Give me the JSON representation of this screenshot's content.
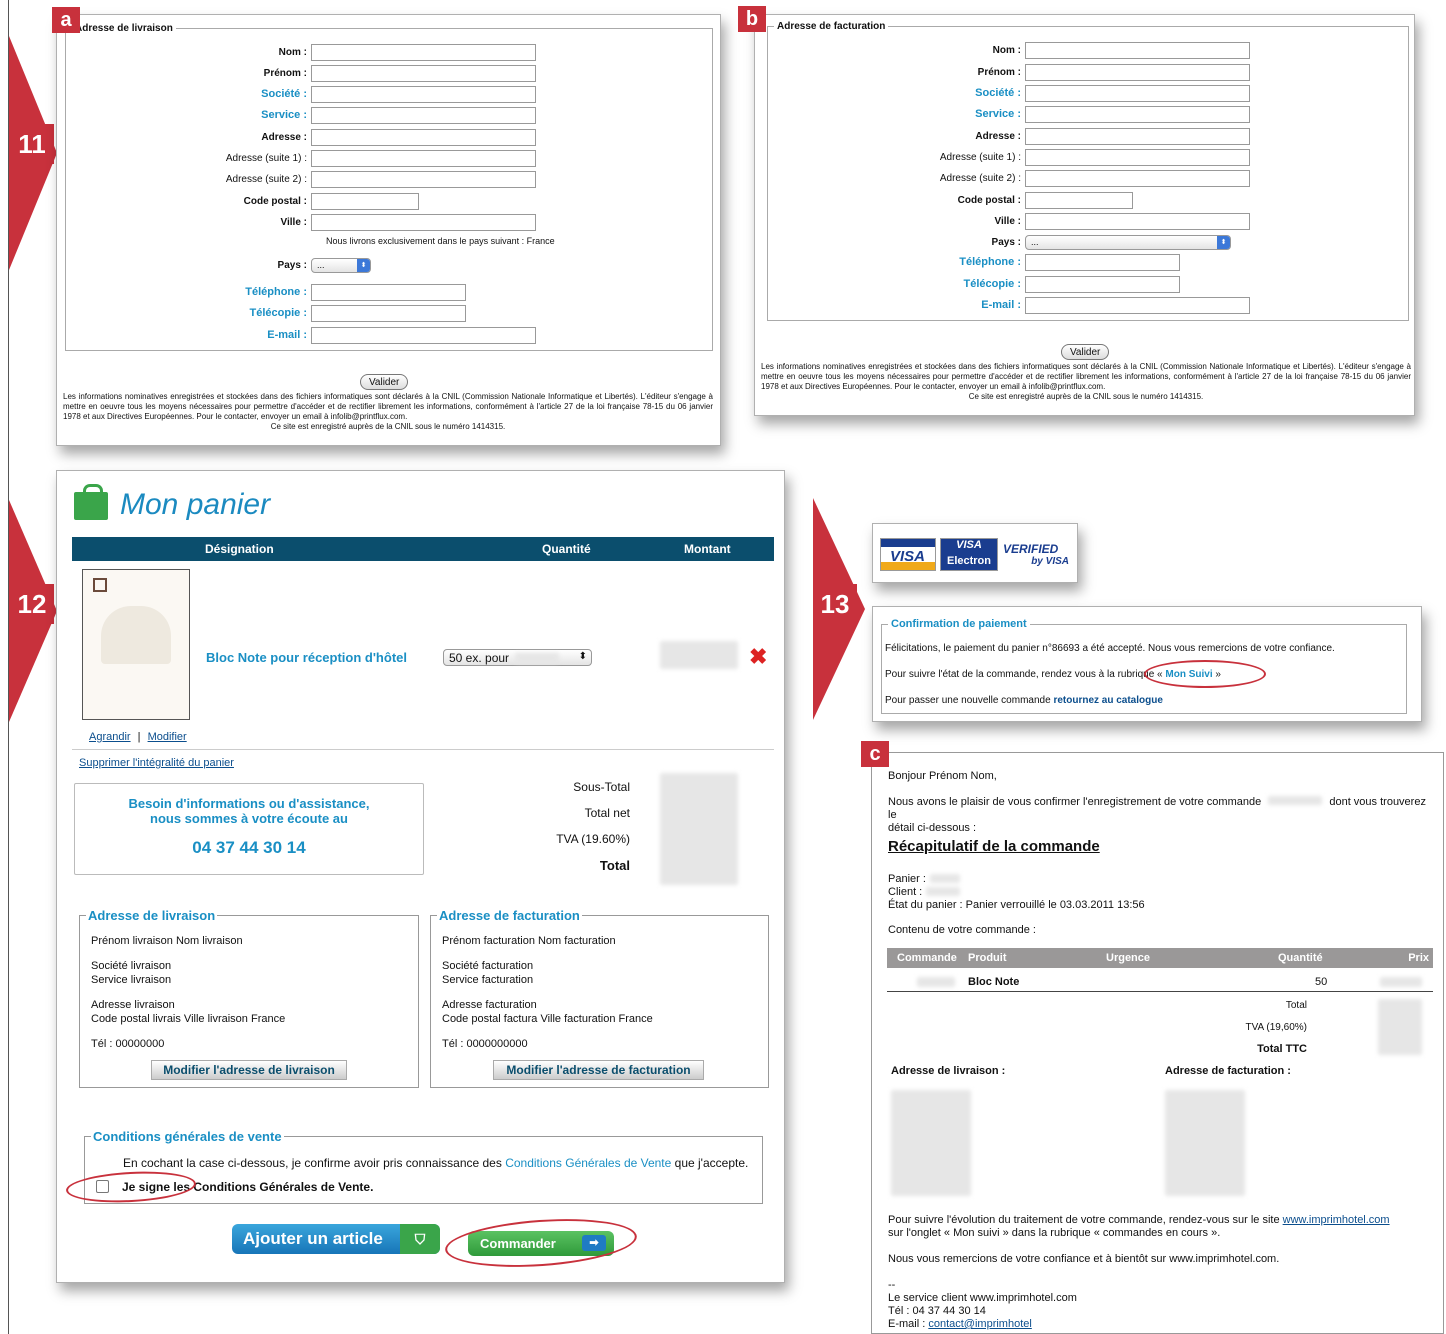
{
  "steps": {
    "s11": "11",
    "s12": "12",
    "s13": "13"
  },
  "tags": {
    "a": "a",
    "b": "b",
    "c": "c"
  },
  "formA": {
    "legend": "Adresse de livraison",
    "labels": {
      "nom": "Nom :",
      "prenom": "Prénom :",
      "societe": "Société :",
      "service": "Service :",
      "adresse": "Adresse :",
      "adresse1": "Adresse (suite 1) :",
      "adresse2": "Adresse (suite 2) :",
      "cp": "Code postal :",
      "ville": "Ville :",
      "pays": "Pays :",
      "tel": "Téléphone :",
      "fax": "Télécopie :",
      "email": "E-mail :"
    },
    "note": "Nous livrons exclusivement dans le pays suivant : France",
    "pays_value": "...",
    "submit": "Valider"
  },
  "formB": {
    "legend": "Adresse de facturation",
    "labels": {
      "nom": "Nom :",
      "prenom": "Prénom :",
      "societe": "Société :",
      "service": "Service :",
      "adresse": "Adresse :",
      "adresse1": "Adresse (suite 1) :",
      "adresse2": "Adresse (suite 2) :",
      "cp": "Code postal :",
      "ville": "Ville :",
      "pays": "Pays :",
      "tel": "Téléphone :",
      "fax": "Télécopie :",
      "email": "E-mail :"
    },
    "pays_value": "...",
    "submit": "Valider"
  },
  "legal": {
    "text": "Les informations nominatives enregistrées et stockées dans des fichiers informatiques sont déclarés à la CNIL (Commission Nationale Informatique et Libertés). L'éditeur s'engage à mettre en oeuvre tous les moyens nécessaires pour permettre d'accéder et de rectifier librement les informations, conformément à l'article 27 de la loi française 78-15 du 06 janvier 1978 et aux Directives Européennes. Pour le contacter, envoyer un email à infolib@printflux.com.",
    "cnil": "Ce site est enregistré auprès de la CNIL sous le numéro 1414315."
  },
  "cart": {
    "title": "Mon panier",
    "headers": {
      "designation": "Désignation",
      "quantite": "Quantité",
      "montant": "Montant"
    },
    "product": "Bloc Note pour réception d'hôtel",
    "qty": "50 ex. pour",
    "agrandir": "Agrandir",
    "sep": "|",
    "modifier": "Modifier",
    "clear": "Supprimer l'intégralité du panier",
    "help1": "Besoin d'informations ou d'assistance,",
    "help2": "nous sommes à votre écoute au",
    "phone": "04 37 44 30 14",
    "totals": {
      "sous_total": "Sous-Total",
      "total_net": "Total net",
      "tva": "TVA (19.60%)",
      "total": "Total"
    },
    "livraison": {
      "legend": "Adresse de livraison",
      "name": "Prénom livraison Nom livraison",
      "soc": "Société livraison",
      "serv": "Service livraison",
      "addr": "Adresse livraison",
      "city": "Code postal livrais Ville livraison France",
      "tel": "Tél : 00000000",
      "btn": "Modifier l'adresse de livraison"
    },
    "facturation": {
      "legend": "Adresse de facturation",
      "name": "Prénom facturation Nom facturation",
      "soc": "Société facturation",
      "serv": "Service facturation",
      "addr": "Adresse facturation",
      "city": "Code postal factura Ville facturation France",
      "tel": "Tél : 0000000000",
      "btn": "Modifier l'adresse de facturation"
    },
    "cgv": {
      "legend": "Conditions générales de vente",
      "text1": "En cochant la case ci-dessous, je confirme avoir pris connaissance des ",
      "link": "Conditions Générales de Vente",
      "text2": " que j'accepte.",
      "check": "Je signe les Conditions Générales de Vente."
    },
    "add_btn": "Ajouter un article",
    "order_btn": "Commander"
  },
  "payment": {
    "visa": "VISA",
    "visa_top": "VISA",
    "electron": "Electron",
    "verified": "VERIFIED",
    "byvisa": "by VISA",
    "legend": "Confirmation de paiement",
    "l1": "Félicitations, le paiement du panier n°86693 a été accepté. Nous vous remercions de votre confiance.",
    "l2a": "Pour suivre l'état de la commande, rendez vous à la rubrique « ",
    "l2link": "Mon Suivi",
    "l2b": " »",
    "l3a": "Pour passer une nouvelle commande ",
    "l3link": "retournez au catalogue"
  },
  "email": {
    "greeting": "Bonjour Prénom Nom,",
    "p1a": "Nous avons le plaisir de vous confirmer l'enregistrement de votre commande",
    "p1b": "dont vous trouverez le",
    "p1c": "détail ci-dessous :",
    "heading": "Récapitulatif de la commande",
    "panier": "Panier :",
    "client": "Client :",
    "etat": "État du panier : Panier verrouillé le 03.03.2011 13:56",
    "contenu": "Contenu de votre commande :",
    "cols": {
      "commande": "Commande",
      "produit": "Produit",
      "urgence": "Urgence",
      "quantite": "Quantité",
      "prix": "Prix"
    },
    "row": {
      "produit": "Bloc Note",
      "quantite": "50"
    },
    "total": "Total",
    "tva": "TVA (19,60%)",
    "ttc": "Total TTC",
    "livraison": "Adresse de livraison :",
    "facturation": "Adresse de facturation :",
    "p2a": "Pour suivre l'évolution du traitement de votre commande, rendez-vous sur le site ",
    "p2link": "www.imprimhotel.com",
    "p2b": "sur l'onglet « Mon suivi » dans la rubrique « commandes en cours ».",
    "p3": "Nous vous remercions de votre confiance et à bientôt sur www.imprimhotel.com.",
    "dash": "--",
    "sig1": "Le service client www.imprimhotel.com",
    "sig2": "Tél : 04 37 44 30 14",
    "sig3a": "E-mail : ",
    "sig3link": "contact@imprimhotel"
  },
  "colors": {
    "brand_red": "#c8313c",
    "header_blue": "#0b4e6d",
    "link_blue": "#1a8fc4",
    "green": "#3aa54a"
  }
}
